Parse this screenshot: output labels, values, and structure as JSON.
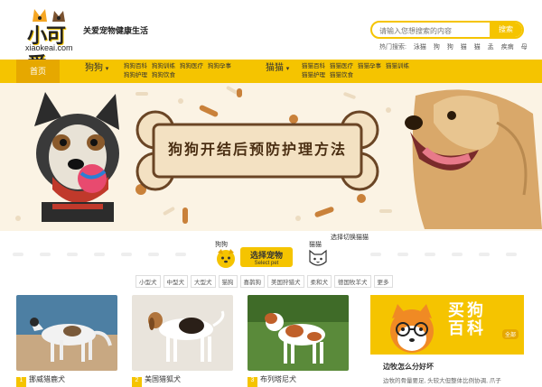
{
  "header": {
    "logo_text": "小可爱",
    "logo_domain": "xiaokeai.com",
    "tagline": "关爱宠物健康生活",
    "search_placeholder": "请输入您想搜索的内容",
    "search_button": "搜索",
    "hot_label": "热门搜索:",
    "hot_items": [
      "泳猫",
      "狗",
      "狗",
      "猫",
      "猫",
      "孟",
      "疾病",
      "母"
    ]
  },
  "nav": {
    "home": "首页",
    "dog_label": "狗狗",
    "dog_links": [
      "狗狗百科",
      "狗狗训练",
      "狗狗医疗",
      "狗狗孕事",
      "狗狗护理",
      "狗狗饮食"
    ],
    "cat_label": "猫猫",
    "cat_links": [
      "猫猫百科",
      "猫猫医疗",
      "猫猫孕事",
      "猫猫训练",
      "猫猫护理",
      "猫猫饮食"
    ]
  },
  "banner": {
    "title": "狗狗开结后预防护理方法"
  },
  "selector": {
    "dog_label": "狗狗",
    "cat_label": "猫猫",
    "select_title": "选择宠物",
    "select_sub": "Select pet",
    "switch_text": "选择切换猫猫"
  },
  "tags": [
    "小型犬",
    "中型犬",
    "大型犬",
    "猫狗",
    "喜鹊狗",
    "美国狩猎犬",
    "柔和犬",
    "德国牧羊犬",
    "更多"
  ],
  "cards": [
    {
      "num": "1",
      "name": "挪威猎鹿犬"
    },
    {
      "num": "2",
      "name": "美国猎狐犬"
    },
    {
      "num": "3",
      "name": "布列塔尼犬"
    }
  ],
  "panel": {
    "title_line1": "买狗",
    "title_line2": "百科",
    "tag": "全部",
    "heading": "边牧怎么分好坏",
    "text": "边牧的骨量要足, 头较大但整体比例协调, 爪子"
  },
  "colors": {
    "accent": "#f5c400",
    "accent_dark": "#e6a800",
    "banner_bg": "#fbf3e4",
    "bone_brown": "#4a2e12"
  }
}
